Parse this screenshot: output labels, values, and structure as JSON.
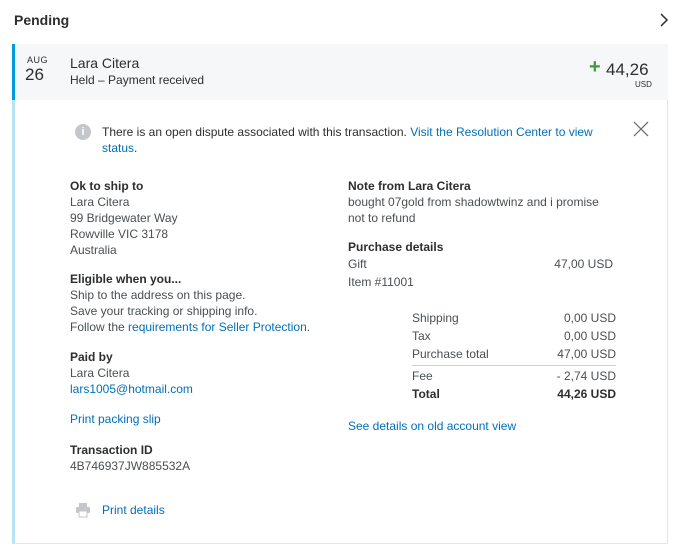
{
  "header": {
    "title": "Pending"
  },
  "summary": {
    "month": "AUG",
    "day": "26",
    "name": "Lara Citera",
    "status": "Held – Payment received",
    "sign": "+",
    "amount": "44,26",
    "currency": "USD"
  },
  "notice": {
    "text": "There is an open dispute associated with this transaction. ",
    "link": "Visit the Resolution Center to view status",
    "end": "."
  },
  "shipping": {
    "heading": "Ok to ship to",
    "lines": [
      "Lara Citera",
      "99 Bridgewater Way",
      "Rowville VIC 3178",
      "Australia"
    ]
  },
  "eligible": {
    "heading": "Eligible when you...",
    "line1": "Ship to the address on this page.",
    "line2": "Save your tracking or shipping info.",
    "line3_prefix": "Follow the ",
    "line3_link": "requirements for Seller Protection",
    "line3_end": "."
  },
  "paid_by": {
    "heading": "Paid by",
    "name": "Lara Citera",
    "email": "lars1005@hotmail.com"
  },
  "print_packing_slip": "Print packing slip",
  "transaction": {
    "heading": "Transaction ID",
    "id": "4B746937JW885532A"
  },
  "print_details": "Print details",
  "note": {
    "heading": "Note from Lara Citera",
    "line1": "bought 07gold from shadowtwinz and i promise",
    "line2": "not to refund"
  },
  "purchase": {
    "heading": "Purchase details",
    "item_name": "Gift",
    "item_price": "47,00 USD",
    "item_number": "Item #11001"
  },
  "totals": {
    "shipping_label": "Shipping",
    "shipping_value": "0,00 USD",
    "tax_label": "Tax",
    "tax_value": "0,00 USD",
    "purchase_total_label": "Purchase total",
    "purchase_total_value": "47,00 USD",
    "fee_label": "Fee",
    "fee_value": "- 2,74 USD",
    "total_label": "Total",
    "total_value": "44,26 USD"
  },
  "old_view_link": "See details on old account view",
  "colors": {
    "accent": "#009cde",
    "link": "#0070ba",
    "positive": "#3c9b3b",
    "panel_bg": "#f6f7f8"
  },
  "icons": {
    "chevron": "chevron-right-icon",
    "info": "info-icon",
    "close": "close-icon",
    "print": "printer-icon"
  }
}
